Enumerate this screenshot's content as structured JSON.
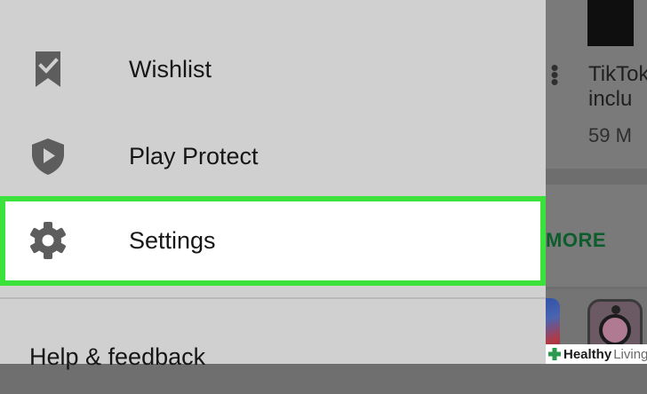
{
  "background_app": {
    "app_title": "TikTok\ninclu",
    "app_size": "59 M",
    "more_link": "MORE"
  },
  "drawer": {
    "items": [
      {
        "label": "Wishlist",
        "icon": "bookmark-check-icon"
      },
      {
        "label": "Play Protect",
        "icon": "shield-play-icon"
      },
      {
        "label": "Settings",
        "icon": "gear-icon",
        "highlighted": true
      },
      {
        "label": "Help & feedback"
      }
    ],
    "highlight_color": "#3be23b"
  },
  "watermark": {
    "brand_bold": "Healthy",
    "brand_light": "Living"
  }
}
